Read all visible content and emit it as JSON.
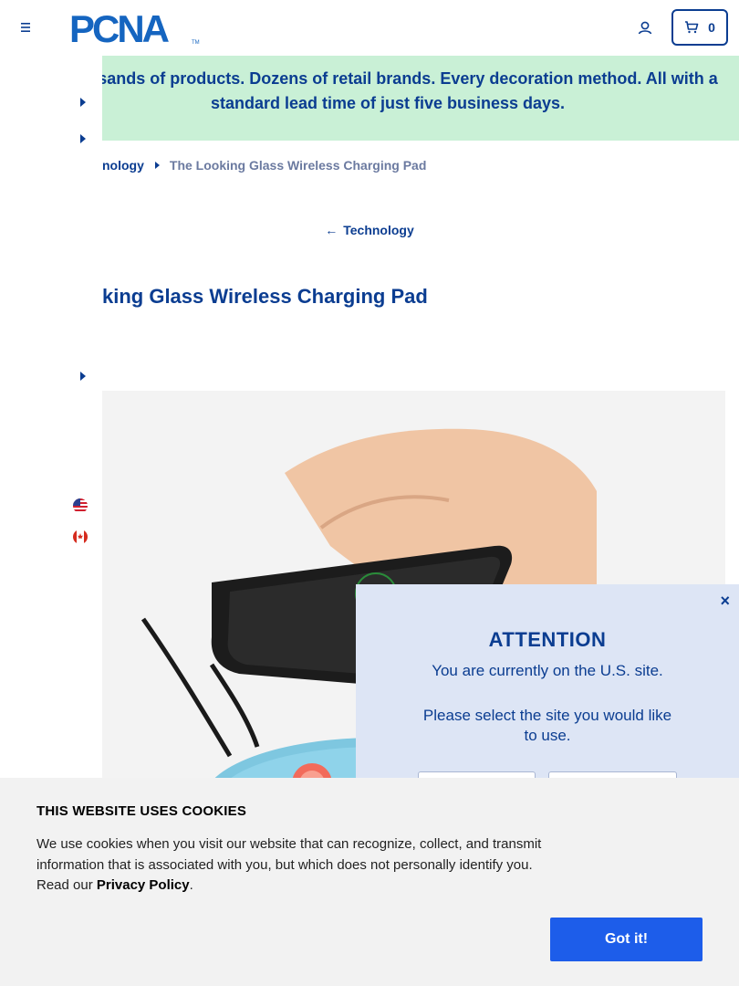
{
  "header": {
    "logo_text": "PCNA",
    "cart_count": "0"
  },
  "banner": {
    "text": "Thousands of products. Dozens of retail brands. Every decoration method. All with a standard lead time of just five business days."
  },
  "breadcrumb": {
    "parent": "nology",
    "current": "The Looking Glass Wireless Charging Pad"
  },
  "back_link": {
    "label": "Technology"
  },
  "product": {
    "title": "king Glass Wireless Charging Pad"
  },
  "attention": {
    "title": "ATTENTION",
    "message": "You are currently on the U.S. site.",
    "prompt": "Please select the site you would like to use.",
    "close": "×"
  },
  "cookie": {
    "title": "THIS WEBSITE USES COOKIES",
    "text_before": "We use cookies when you visit our website that can recognize, collect, and transmit information that is associated with you, but which does not personally identify you. Read our ",
    "link": "Privacy Policy",
    "text_after": ".",
    "button": "Got it!"
  },
  "colors": {
    "brand_blue": "#0b3d91",
    "banner_green": "#c9f0d6",
    "modal_bg": "#dde5f5",
    "cookie_bg": "#f2f2f2",
    "button_blue": "#1d5dea"
  }
}
